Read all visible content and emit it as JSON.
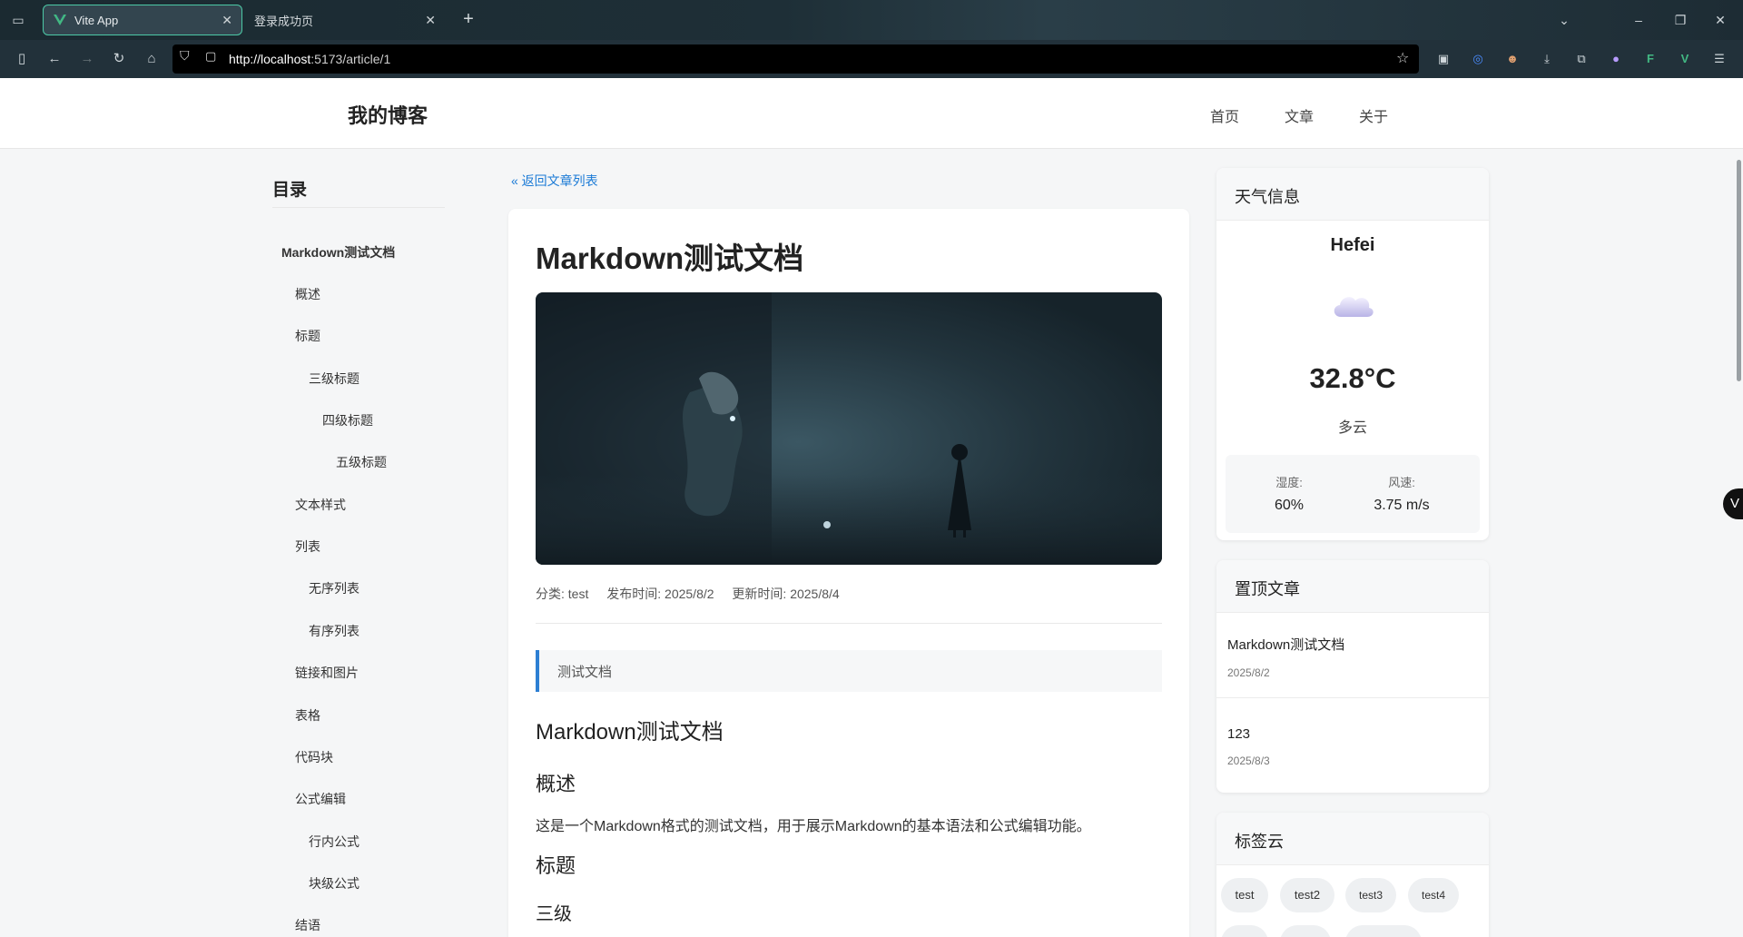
{
  "browser": {
    "tabs": [
      {
        "title": "Vite App",
        "active": true
      },
      {
        "title": "登录成功页",
        "active": false
      }
    ],
    "url_host": "http://localhost",
    "url_rest": ":5173/article/1"
  },
  "site": {
    "title": "我的博客",
    "nav": [
      "首页",
      "文章",
      "关于"
    ]
  },
  "toc": {
    "title": "目录",
    "items": [
      {
        "label": "Markdown测试文档",
        "level": 1
      },
      {
        "label": "概述",
        "level": 2
      },
      {
        "label": "标题",
        "level": 2
      },
      {
        "label": "三级标题",
        "level": 3
      },
      {
        "label": "四级标题",
        "level": 4
      },
      {
        "label": "五级标题",
        "level": 5
      },
      {
        "label": "文本样式",
        "level": 2
      },
      {
        "label": "列表",
        "level": 2
      },
      {
        "label": "无序列表",
        "level": 3
      },
      {
        "label": "有序列表",
        "level": 3
      },
      {
        "label": "链接和图片",
        "level": 2
      },
      {
        "label": "表格",
        "level": 2
      },
      {
        "label": "代码块",
        "level": 2
      },
      {
        "label": "公式编辑",
        "level": 2
      },
      {
        "label": "行内公式",
        "level": 3
      },
      {
        "label": "块级公式",
        "level": 3
      },
      {
        "label": "结语",
        "level": 2
      }
    ]
  },
  "article": {
    "back_link": "« 返回文章列表",
    "title": "Markdown测试文档",
    "category": "分类: test",
    "published": "发布时间: 2025/8/2",
    "updated": "更新时间: 2025/8/4",
    "summary": "测试文档",
    "h1": "Markdown测试文档",
    "h2_overview": "概述",
    "overview_text": "这是一个Markdown格式的测试文档，用于展示Markdown的基本语法和公式编辑功能。",
    "h2_headings": "标题",
    "h3_partial": "三级"
  },
  "weather": {
    "heading": "天气信息",
    "city": "Hefei",
    "icon": "cloud-icon",
    "temperature": "32.8°C",
    "description": "多云",
    "humidity_label": "湿度:",
    "humidity": "60%",
    "wind_label": "风速:",
    "wind": "3.75 m/s"
  },
  "pinned": {
    "heading": "置顶文章",
    "items": [
      {
        "title": "Markdown测试文档",
        "date": "2025/8/2"
      },
      {
        "title": "123",
        "date": "2025/8/3"
      }
    ]
  },
  "tags": {
    "heading": "标签云",
    "items": [
      "test",
      "test2",
      "test3",
      "test4"
    ]
  },
  "colors": {
    "accent": "#2d7fd3",
    "link": "#1a7ad6",
    "vue_green": "#42b883"
  }
}
